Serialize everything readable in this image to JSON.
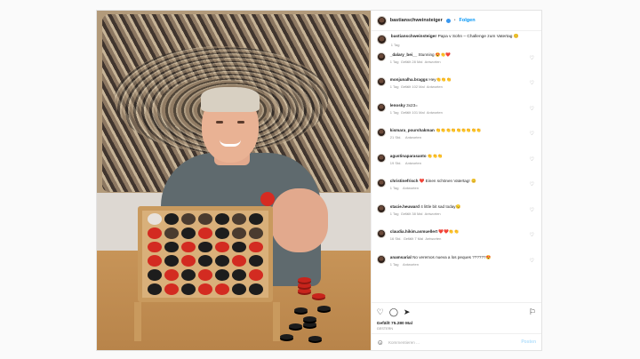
{
  "header": {
    "username": "bastianschweinsteiger",
    "separator": "•",
    "follow_label": "Folgen"
  },
  "caption": {
    "username": "bastianschweinsteiger",
    "text": "Papa v Sohn – Challenge zum Vatertag ",
    "emoji": "😊",
    "time": "1 Tag"
  },
  "comments": [
    {
      "username": "_dalary_bei__",
      "text": "Stunning 😍👏❤️",
      "time": "1 Tag",
      "likes": "Gefällt 28 Mal",
      "reply": "Antworten"
    },
    {
      "username": "monjunalha.braggs",
      "text": "Hey👏👏👏",
      "time": "1 Tag",
      "likes": "Gefällt 102 Mal",
      "reply": "Antworten"
    },
    {
      "username": "lenosky",
      "text": "3x23=",
      "time": "1 Tag",
      "likes": "Gefällt 101 Mal",
      "reply": "Antworten"
    },
    {
      "username": "kismara_pourshakman",
      "text": "👏👏👏👏👏👏👏👏👏",
      "time": "21 Std.",
      "likes": "",
      "reply": "Antworten"
    },
    {
      "username": "agustinaparasanto",
      "text": "👏👏👏",
      "time": "19 Std.",
      "likes": "",
      "reply": "Antworten"
    },
    {
      "username": "christinefrisch",
      "text": "❤️ Einen schönen Vatertag! 😊",
      "time": "1 Tag",
      "likes": "",
      "reply": "Antworten"
    },
    {
      "username": "stacie.heuward",
      "text": "4 little bit sad today😏",
      "time": "1 Tag",
      "likes": "Gefällt 38 Mal",
      "reply": "Antworten"
    },
    {
      "username": "claudia.hikim.asmuellert",
      "text": "❤️❤️👏👏",
      "time": "16 Std.",
      "likes": "Gefällt 7 Mal",
      "reply": "Antworten"
    },
    {
      "username": "anamsarial",
      "text": "No veremos nueva a los peques ??????😍",
      "time": "1 Tag",
      "likes": "",
      "reply": "Antworten"
    }
  ],
  "actions": {
    "like_icon": "heart-icon",
    "comment_icon": "comment-icon",
    "share_icon": "share-icon",
    "save_icon": "bookmark-icon",
    "like_glyph": "♡",
    "comment_glyph": "◯",
    "share_glyph": "➤",
    "save_glyph": "⚐"
  },
  "likes_text": "Gefällt 75.280 Mal",
  "date_text": "Gestern",
  "add_comment": {
    "placeholder": "Kommentieren ...",
    "post_label": "Posten",
    "emoji_glyph": "☺"
  },
  "comment_heart_glyph": "♡",
  "colors": {
    "link": "#0095f6",
    "text": "#262626",
    "muted": "#8e8e8e",
    "chip_red": "#d32b21",
    "chip_black": "#1d1d1d"
  },
  "board": {
    "columns": 7,
    "rows": 6,
    "cells": [
      "w",
      "b",
      "e",
      "e",
      "b",
      "e",
      "b",
      "r",
      "e",
      "b",
      "r",
      "b",
      "e",
      "e",
      "r",
      "b",
      "r",
      "b",
      "r",
      "b",
      "r",
      "r",
      "b",
      "r",
      "b",
      "b",
      "r",
      "b",
      "b",
      "r",
      "b",
      "r",
      "b",
      "b",
      "r",
      "b",
      "r",
      "b",
      "r",
      "r",
      "b",
      "b"
    ]
  }
}
